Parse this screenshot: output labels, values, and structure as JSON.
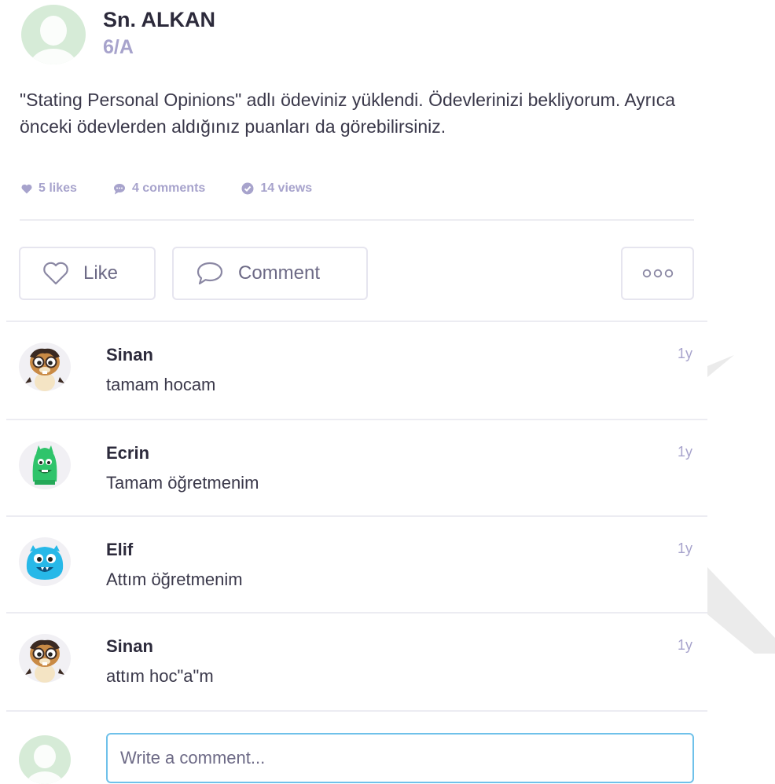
{
  "post": {
    "author_name": "Sn. ALKAN",
    "author_class": "6/A",
    "body": "\"Stating Personal Opinions\" adlı ödeviniz yüklendi. Ödevlerinizi bekliyorum. Ayrıca önceki ödevlerden aldığınız puanları da görebilirsiniz.",
    "stats": {
      "likes": "5 likes",
      "comments": "4 comments",
      "views": "14 views"
    }
  },
  "actions": {
    "like_label": "Like",
    "comment_label": "Comment"
  },
  "comments": [
    {
      "name": "Sinan",
      "text": "tamam hocam",
      "time": "1y",
      "avatar": "cat-monster-avatar"
    },
    {
      "name": "Ecrin",
      "text": "Tamam öğretmenim",
      "time": "1y",
      "avatar": "green-monster-avatar"
    },
    {
      "name": "Elif",
      "text": "Attım öğretmenim",
      "time": "1y",
      "avatar": "blue-monster-avatar"
    },
    {
      "name": "Sinan",
      "text": "attım hoc\"a\"m",
      "time": "1y",
      "avatar": "cat-monster-avatar"
    }
  ],
  "composer": {
    "placeholder": "Write a comment..."
  },
  "colors": {
    "accent": "#a7a3cc",
    "input_border": "#6fc1ea",
    "avatar_bg": "#d6ebd7"
  }
}
